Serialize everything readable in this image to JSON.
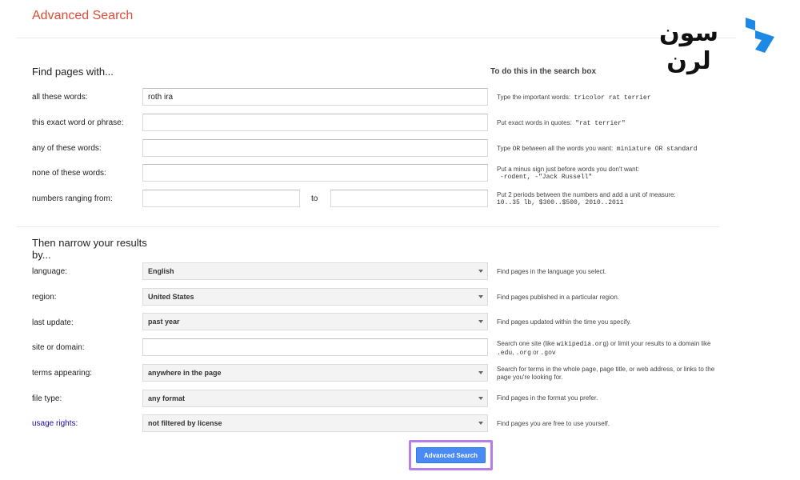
{
  "header": {
    "title": "Advanced Search",
    "logo_text": "سون لرن"
  },
  "find_section": {
    "heading": "Find pages with...",
    "hint_heading": "To do this in the search box",
    "rows": [
      {
        "label": "all these words:",
        "value": "roth ira",
        "hint": "Type the important words:",
        "hint_code": "tricolor rat terrier"
      },
      {
        "label": "this exact word or phrase:",
        "value": "",
        "hint": "Put exact words in quotes:",
        "hint_code": "\"rat terrier\""
      },
      {
        "label": "any of these words:",
        "value": "",
        "hint_pre": "Type",
        "hint_or": "OR",
        "hint": "between all the words you want:",
        "hint_code": "miniature OR standard"
      },
      {
        "label": "none of these words:",
        "value": "",
        "hint": "Put a minus sign just before words you don't want:",
        "hint_code": "-rodent, -\"Jack Russell\""
      },
      {
        "label": "numbers ranging from:",
        "value_from": "",
        "value_to": "",
        "to_label": "to",
        "hint": "Put 2 periods between the numbers and add a unit of measure:",
        "hint_code": "10..35 lb, $300..$500, 2010..2011"
      }
    ]
  },
  "narrow_section": {
    "heading": "Then narrow your results by...",
    "rows": [
      {
        "label": "language:",
        "value": "English",
        "hint": "Find pages in the language you select."
      },
      {
        "label": "region:",
        "value": "United States",
        "hint": "Find pages published in a particular region."
      },
      {
        "label": "last update:",
        "value": "past year",
        "hint": "Find pages updated within the time you specify."
      },
      {
        "label": "site or domain:",
        "value": "",
        "hint_a": "Search one site (like",
        "hint_code_a": "wikipedia.org",
        "hint_b": ") or limit your results to a domain like",
        "hint_code_b": ".edu",
        "hint_c": ",",
        "hint_code_c": ".org",
        "hint_d": "or",
        "hint_code_d": ".gov"
      },
      {
        "label": "terms appearing:",
        "value": "anywhere in the page",
        "hint": "Search for terms in the whole page, page title, or web address, or links to the page you're looking for."
      },
      {
        "label": "file type:",
        "value": "any format",
        "hint": "Find pages in the format you prefer."
      },
      {
        "label": "usage rights:",
        "value": "not filtered by license",
        "hint": "Find pages you are free to use yourself."
      }
    ]
  },
  "submit": {
    "label": "Advanced Search"
  },
  "colors": {
    "title": "#dd4b39",
    "link": "#1a0dab",
    "button": "#4a8af4",
    "highlight": "#b77ee8",
    "logo_accent": "#1e88e5"
  }
}
